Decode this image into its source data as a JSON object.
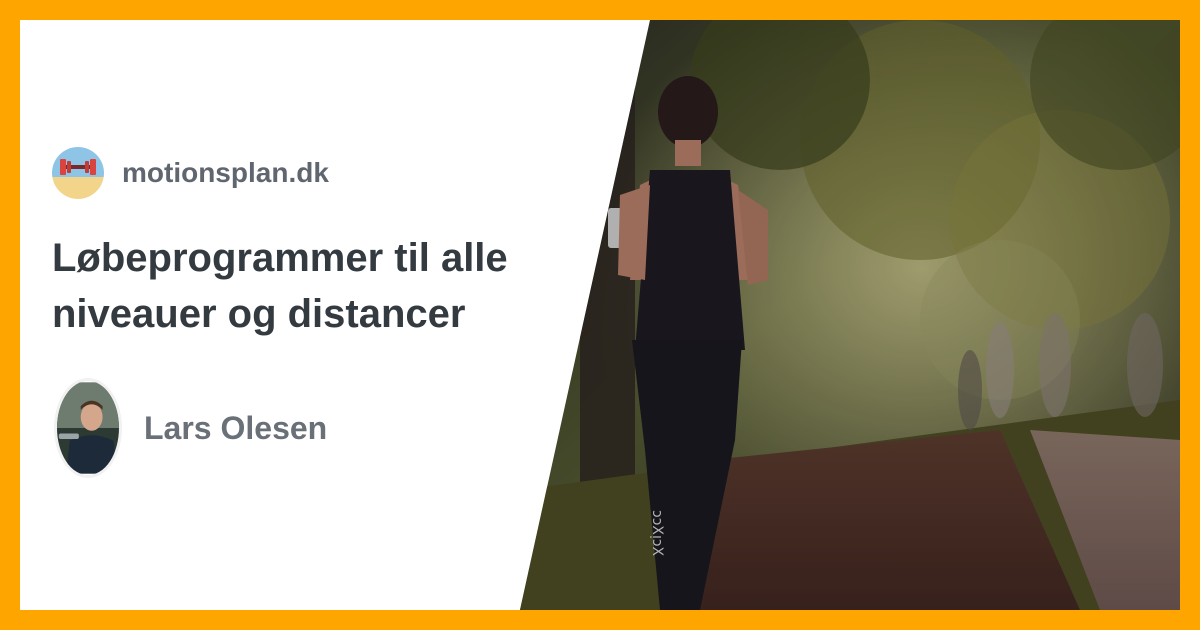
{
  "site": {
    "name": "motionsplan.dk",
    "logo_icon": "dumbbell-beach-icon"
  },
  "article": {
    "title": "Løbeprogrammer til alle niveauer og distancer",
    "image_icon": "runner-park-photo"
  },
  "author": {
    "name": "Lars Olesen",
    "avatar_icon": "author-avatar"
  },
  "colors": {
    "border": "#FFA500",
    "title": "#333a40",
    "muted": "#5f6670"
  }
}
